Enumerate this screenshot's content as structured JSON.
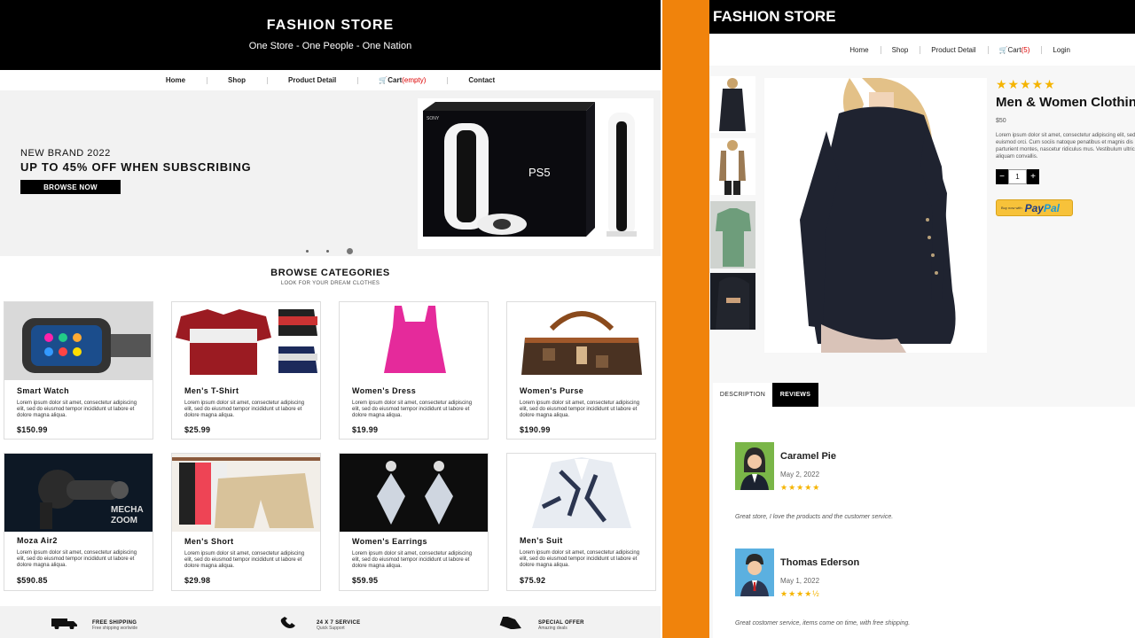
{
  "left": {
    "brand": "FASHION STORE",
    "tagline": "One Store - One People - One Nation",
    "nav": {
      "home": "Home",
      "shop": "Shop",
      "product_detail": "Product Detail",
      "cart_label": "Cart",
      "cart_status": "(empty)",
      "contact": "Contact"
    },
    "hero": {
      "kicker": "NEW BRAND 2022",
      "headline": "UP TO 45% OFF WHEN SUBSCRIBING",
      "button": "BROWSE NOW"
    },
    "categories": {
      "title": "BROWSE CATEGORIES",
      "subtitle": "LOOK FOR YOUR DREAM CLOTHES"
    },
    "products": [
      {
        "name": "Smart Watch",
        "desc": "Lorem ipsum dolor sit amet, consectetur adipiscing elit, sed do eiusmod tempor incididunt ut labore et dolore magna aliqua.",
        "price": "$150.99"
      },
      {
        "name": "Men's T-Shirt",
        "desc": "Lorem ipsum dolor sit amet, consectetur adipiscing elit, sed do eiusmod tempor incididunt ut labore et dolore magna aliqua.",
        "price": "$25.99"
      },
      {
        "name": "Women's Dress",
        "desc": "Lorem ipsum dolor sit amet, consectetur adipiscing elit, sed do eiusmod tempor incididunt ut labore et dolore magna aliqua.",
        "price": "$19.99"
      },
      {
        "name": "Women's Purse",
        "desc": "Lorem ipsum dolor sit amet, consectetur adipiscing elit, sed do eiusmod tempor incididunt ut labore et dolore magna aliqua.",
        "price": "$190.99"
      },
      {
        "name": "Moza Air2",
        "desc": "Lorem ipsum dolor sit amet, consectetur adipiscing elit, sed do eiusmod tempor incididunt ut labore et dolore magna aliqua.",
        "price": "$590.85"
      },
      {
        "name": "Men's Short",
        "desc": "Lorem ipsum dolor sit amet, consectetur adipiscing elit, sed do eiusmod tempor incididunt ut labore et dolore magna aliqua.",
        "price": "$29.98"
      },
      {
        "name": "Women's Earrings",
        "desc": "Lorem ipsum dolor sit amet, consectetur adipiscing elit, sed do eiusmod tempor incididunt ut labore et dolore magna aliqua.",
        "price": "$59.95"
      },
      {
        "name": "Men's Suit",
        "desc": "Lorem ipsum dolor sit amet, consectetur adipiscing elit, sed do eiusmod tempor incididunt ut labore et dolore magna aliqua.",
        "price": "$75.92"
      }
    ],
    "features": [
      {
        "title": "FREE SHIPPING",
        "sub": "Free shipping worlwide"
      },
      {
        "title": "24 X 7 SERVICE",
        "sub": "Quick Support"
      },
      {
        "title": "SPECIAL OFFER",
        "sub": "Amazing deals"
      }
    ]
  },
  "right": {
    "brand": "FASHION STORE",
    "nav": {
      "home": "Home",
      "shop": "Shop",
      "product_detail": "Product Detail",
      "cart_label": "Cart",
      "cart_count": "(5)",
      "login": "Login"
    },
    "product": {
      "stars": "★★★★★",
      "title": "Men & Women Clothing",
      "price": "$50",
      "desc": "Lorem ipsum dolor sit amet, consectetur adipiscing elit, sed do euismod orci. Cum sociis natoque penatibus et magnis dis parturient montes, nascetur ridiculus mus. Vestibulum ultricies aliquam convallis.",
      "qty": "1",
      "qty_minus": "−",
      "qty_plus": "+"
    },
    "paypal": {
      "small": "Buy now with",
      "brand_a": "Pay",
      "brand_b": "Pal"
    },
    "tabs": {
      "description": "DESCRIPTION",
      "reviews": "REVIEWS"
    },
    "reviews": [
      {
        "name": "Caramel Pie",
        "date": "May 2, 2022",
        "stars": "★★★★★",
        "text": "Great store, I love the products and the customer service."
      },
      {
        "name": "Thomas Ederson",
        "date": "May 1, 2022",
        "stars": "★★★★½",
        "text": "Great costomer service, items come on time, with free shipping."
      }
    ]
  },
  "colors": {
    "accent_orange": "#f0830c",
    "header_black": "#000000",
    "star_gold": "#f5b400",
    "cart_red": "#dd0000"
  }
}
